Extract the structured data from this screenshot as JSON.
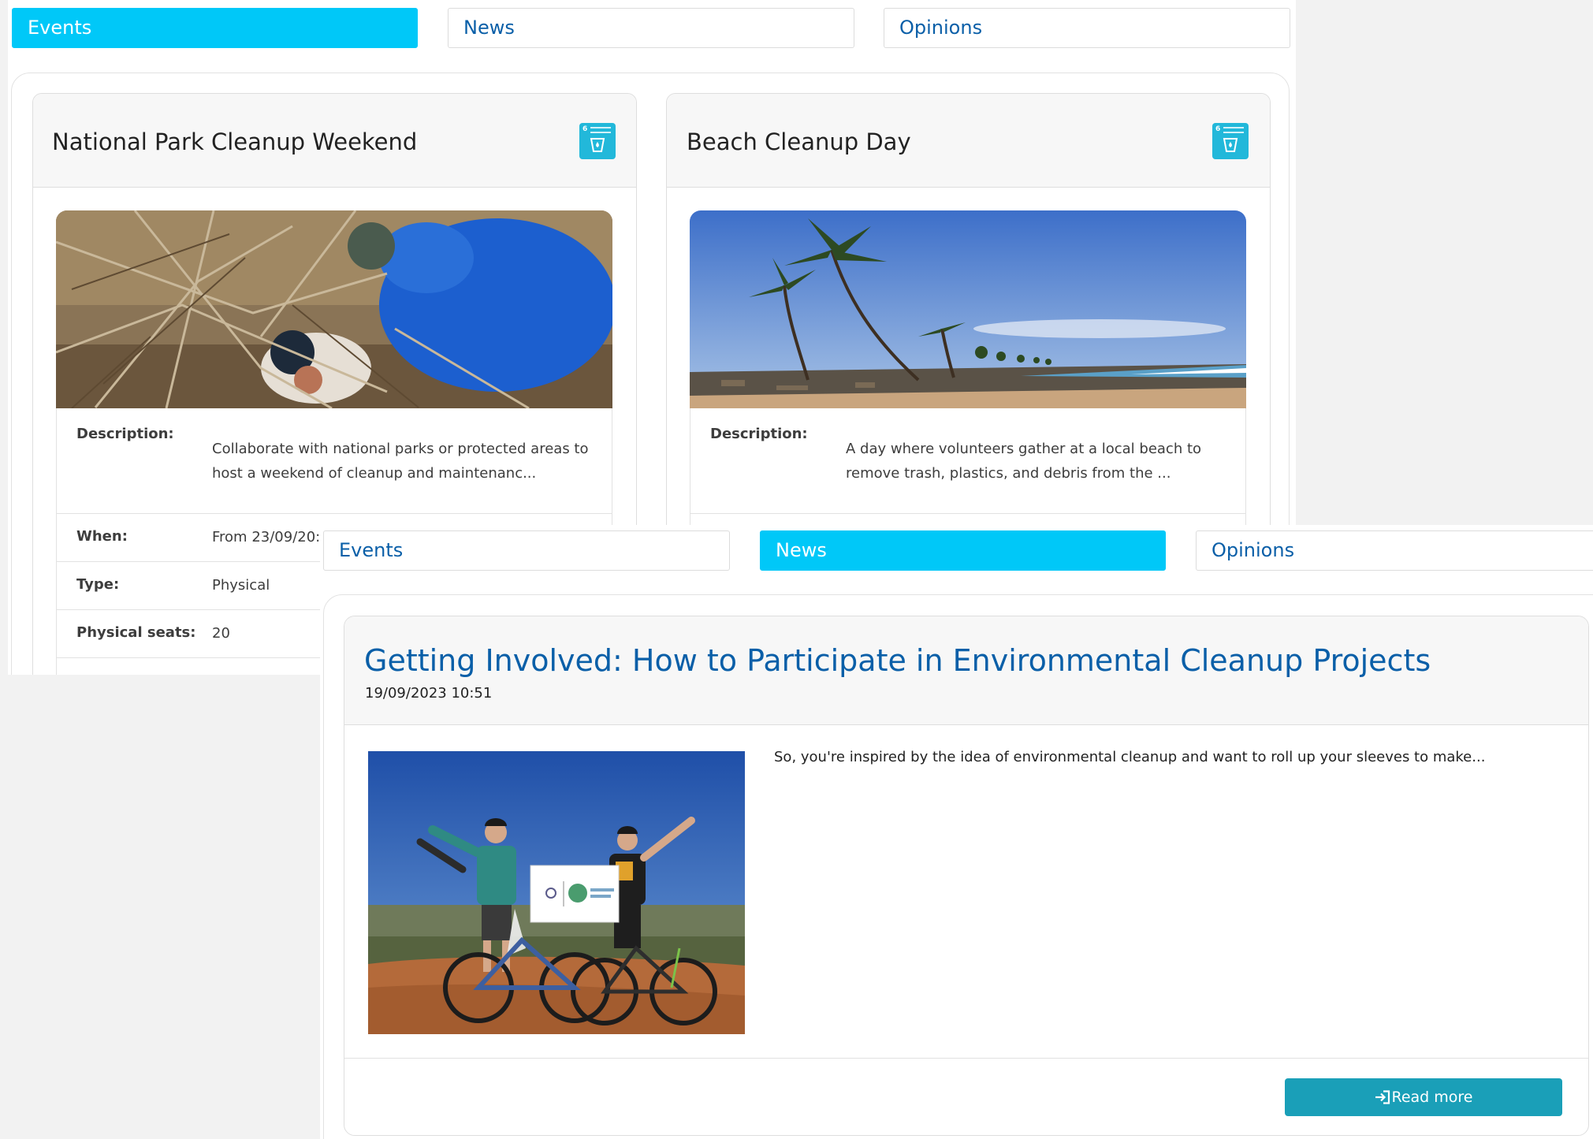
{
  "events_panel": {
    "tabs": [
      {
        "label": "Events",
        "active": true
      },
      {
        "label": "News",
        "active": false
      },
      {
        "label": "Opinions",
        "active": false
      }
    ],
    "cards": [
      {
        "title": "National Park Cleanup Weekend",
        "sdg_badge": {
          "number": "6",
          "icon": "water-tap-icon",
          "color": "#22b8da"
        },
        "image_subject": "volunteers-clearing-brush",
        "description_label": "Description:",
        "description_line1": "Collaborate with national parks or protected areas to",
        "description_line2": "host a weekend of cleanup and maintenanc...",
        "when_label": "When:",
        "when_value": "From 23/09/20:",
        "type_label": "Type:",
        "type_value": "Physical",
        "seats_label": "Physical seats:",
        "seats_value": "20"
      },
      {
        "title": "Beach Cleanup Day",
        "sdg_badge": {
          "number": "6",
          "icon": "water-tap-icon",
          "color": "#22b8da"
        },
        "image_subject": "palm-beach-with-debris",
        "description_label": "Description:",
        "description_line1": "A day where volunteers gather at a local beach to",
        "description_line2": "remove trash, plastics, and debris from the ..."
      }
    ]
  },
  "news_panel": {
    "tabs": [
      {
        "label": "Events",
        "active": false
      },
      {
        "label": "News",
        "active": true
      },
      {
        "label": "Opinions",
        "active": false
      }
    ],
    "article": {
      "title": "Getting Involved: How to Participate in Environmental Cleanup Projects",
      "date": "19/09/2023 10:51",
      "image_subject": "cyclists-holding-cleanup-banner",
      "excerpt": "So, you're inspired by the idea of environmental cleanup and want to roll up your sleeves to make...",
      "read_more_label": "Read more",
      "read_more_icon": "sign-in-arrow-icon"
    }
  },
  "colors": {
    "active_tab": "#00c8f8",
    "link_blue": "#0a5fa8",
    "button_teal": "#1a9fb8",
    "sdg_badge": "#22b8da"
  }
}
